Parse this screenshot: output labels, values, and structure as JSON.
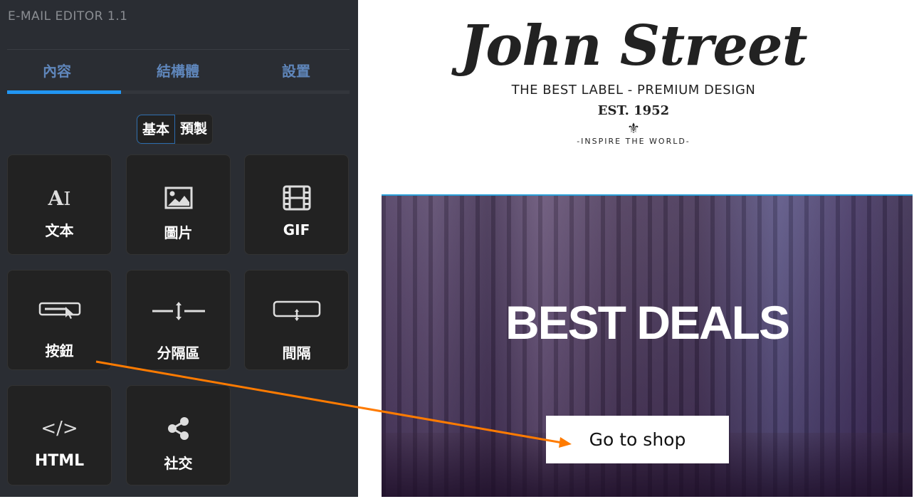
{
  "sidebar": {
    "title": "E-MAIL EDITOR 1.1",
    "tabs": [
      {
        "label": "內容",
        "active": true
      },
      {
        "label": "結構體"
      },
      {
        "label": "設置"
      }
    ],
    "segments": [
      {
        "label": "基本",
        "active": true
      },
      {
        "label": "預製"
      }
    ],
    "blocks": [
      {
        "label": "文本",
        "icon": "text-icon"
      },
      {
        "label": "圖片",
        "icon": "image-icon"
      },
      {
        "label": "GIF",
        "icon": "film-icon"
      },
      {
        "label": "按鈕",
        "icon": "button-icon"
      },
      {
        "label": "分隔區",
        "icon": "divider-icon"
      },
      {
        "label": "間隔",
        "icon": "spacer-icon"
      },
      {
        "label": "HTML",
        "icon": "code-icon"
      },
      {
        "label": "社交",
        "icon": "share-icon"
      }
    ],
    "accent": "#2196f3"
  },
  "email": {
    "logo": {
      "name": "John Street",
      "tagline": "THE BEST LABEL - PREMIUM DESIGN",
      "est": "EST. 1952",
      "motto": "-INSPIRE THE WORLD-"
    },
    "hero": {
      "title": "BEST DEALS",
      "button": "Go to shop"
    }
  },
  "annotation": {
    "color": "#ff7b00"
  }
}
